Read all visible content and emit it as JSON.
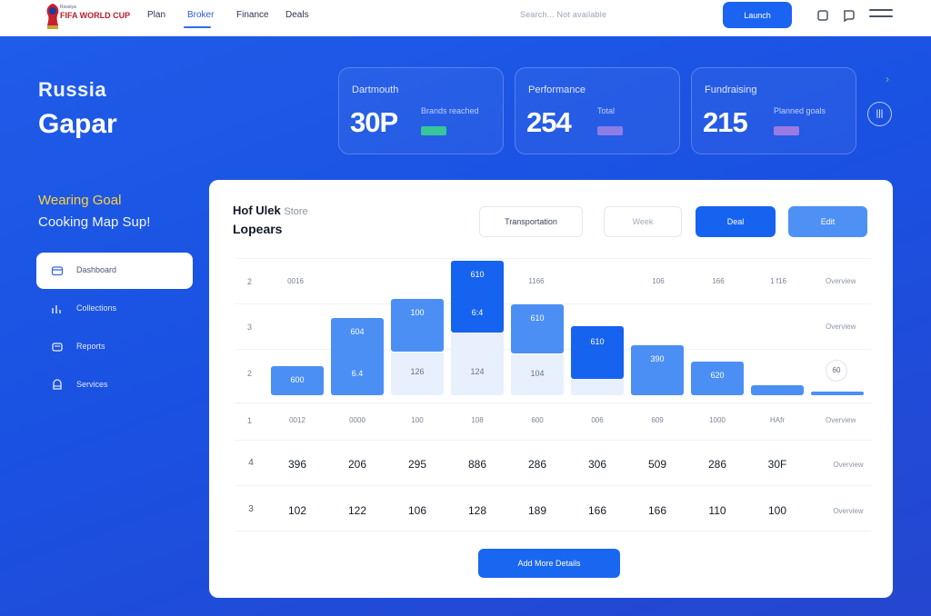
{
  "brand": {
    "line1": "Rossiya",
    "line2": "FIFA WORLD CUP"
  },
  "nav": {
    "links": [
      "Plan",
      "Broker",
      "Finance",
      "Deals"
    ]
  },
  "header": {
    "search_placeholder": "Search... Not available",
    "cta": "Launch"
  },
  "hero": {
    "eyebrow": "Russia",
    "title": "Gapar"
  },
  "stats": [
    {
      "label": "Dartmouth",
      "value": "30P",
      "sub": "Brands reached",
      "pill_color": "#38c59a"
    },
    {
      "label": "Performance",
      "value": "254",
      "sub": "Total",
      "pill_color": "#8c7de6"
    },
    {
      "label": "Fundraising",
      "value": "215",
      "sub": "Planned goals",
      "pill_color": "#9b7ae4"
    }
  ],
  "hero_controls": {
    "chevron": "›",
    "round_button": "|||"
  },
  "sidebar": {
    "heading1": "Wearing Goal",
    "heading2": "Cooking Map Sup!",
    "items": [
      {
        "label": "Dashboard",
        "icon": "folder-icon"
      },
      {
        "label": "Collections",
        "icon": "chart-icon"
      },
      {
        "label": "Reports",
        "icon": "document-icon"
      },
      {
        "label": "Services",
        "icon": "settings-icon"
      }
    ]
  },
  "panel": {
    "title_main": "Hof Ulek",
    "title_muted": "Store",
    "subtitle": "Lopears",
    "buttons": [
      "Transportation",
      "Week",
      "Deal",
      "Edit"
    ],
    "row_labels": [
      "2",
      "3",
      "2",
      "1"
    ],
    "col_top": [
      "0016",
      "",
      "",
      "",
      "1166",
      "",
      "",
      "106",
      "166",
      "1 f16"
    ],
    "side_labels": [
      "Overview",
      "Overview",
      "",
      "Overview"
    ],
    "round_label": "60",
    "bars": [
      {
        "label": "600",
        "ghost": ""
      },
      {
        "label": "604",
        "ghost": "",
        "bottom": "6.4"
      },
      {
        "label": "100",
        "ghost": "126"
      },
      {
        "label": "610",
        "ghost": "124",
        "mid": "6:4"
      },
      {
        "label": "610",
        "ghost": "104"
      },
      {
        "label": "610",
        "ghost": ""
      },
      {
        "label": "390",
        "ghost": ""
      },
      {
        "label": "620",
        "ghost": ""
      },
      {
        "label": "",
        "ghost": ""
      },
      {
        "label": "",
        "ghost": ""
      }
    ],
    "axis_row": [
      "0012",
      "0000",
      "100",
      "108",
      "600",
      "006",
      "609",
      "1000",
      "HAfr"
    ],
    "table": [
      {
        "lead": "4",
        "values": [
          "396",
          "206",
          "295",
          "886",
          "286",
          "306",
          "509",
          "286",
          "30F"
        ],
        "tail": "Overview"
      },
      {
        "lead": "3",
        "values": [
          "102",
          "122",
          "106",
          "128",
          "189",
          "166",
          "166",
          "110",
          "100"
        ],
        "tail": "Overview"
      }
    ],
    "cta": "Add More Details"
  },
  "colors": {
    "accent": "#1663f0",
    "bar_primary": "#4b8ff5",
    "bar_strong": "#1663f0",
    "background": "#1d4fe0",
    "highlight": "#ffd23a"
  }
}
